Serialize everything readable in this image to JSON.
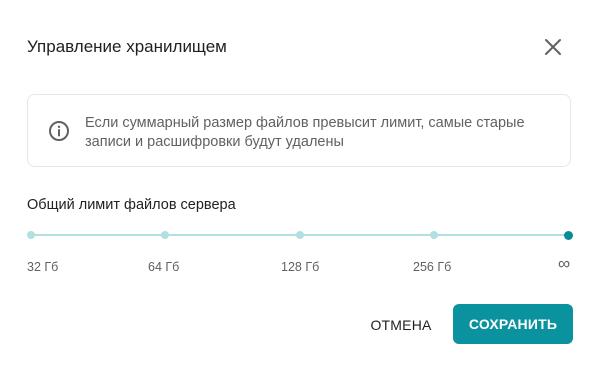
{
  "dialog": {
    "title": "Управление хранилищем",
    "close_icon": "close-icon"
  },
  "info": {
    "icon": "info-icon",
    "text": "Если суммарный размер файлов превысит лимит, самые старые записи и расшифровки будут удалены"
  },
  "slider": {
    "label": "Общий лимит файлов сервера",
    "ticks": [
      "32 Гб",
      "64 Гб",
      "128 Гб",
      "256 Гб",
      "∞"
    ],
    "selected_index": 4,
    "selected_value": "∞"
  },
  "actions": {
    "cancel_label": "ОТМЕНА",
    "save_label": "СОХРАНИТЬ"
  },
  "colors": {
    "accent": "#0a939f",
    "track": "#b2dfe0",
    "text_primary": "#212121",
    "text_secondary": "#616161",
    "border": "#e6e6e6"
  }
}
